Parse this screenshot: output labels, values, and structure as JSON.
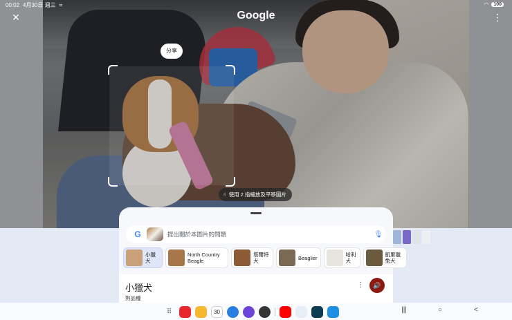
{
  "status": {
    "time": "00:02",
    "date": "4月30日 週三",
    "battery": "100"
  },
  "header": {
    "title": "Google"
  },
  "photo": {
    "share_label": "分享",
    "hint": "使用 2 指縮放及平移圖片"
  },
  "search": {
    "placeholder": "提出關於本圖片的問題"
  },
  "chips": [
    {
      "label": "小獵犬",
      "color": "#c9a07a"
    },
    {
      "label": "North Country Beagle",
      "color": "#a77649"
    },
    {
      "label": "塔爾特犬",
      "color": "#8c5b36"
    },
    {
      "label": "Beaglier",
      "color": "#7a6a53"
    },
    {
      "label": "哈利犬",
      "color": "#e8e4de"
    },
    {
      "label": "凱里獵兔犬",
      "color": "#6b5a3e"
    }
  ],
  "result": {
    "title": "小獵犬",
    "subtitle": "狗品種"
  },
  "dock": {
    "calendar_day": "30"
  },
  "colors": {
    "accent": "#8b1b10",
    "chip_active": "#dfe6f7"
  }
}
